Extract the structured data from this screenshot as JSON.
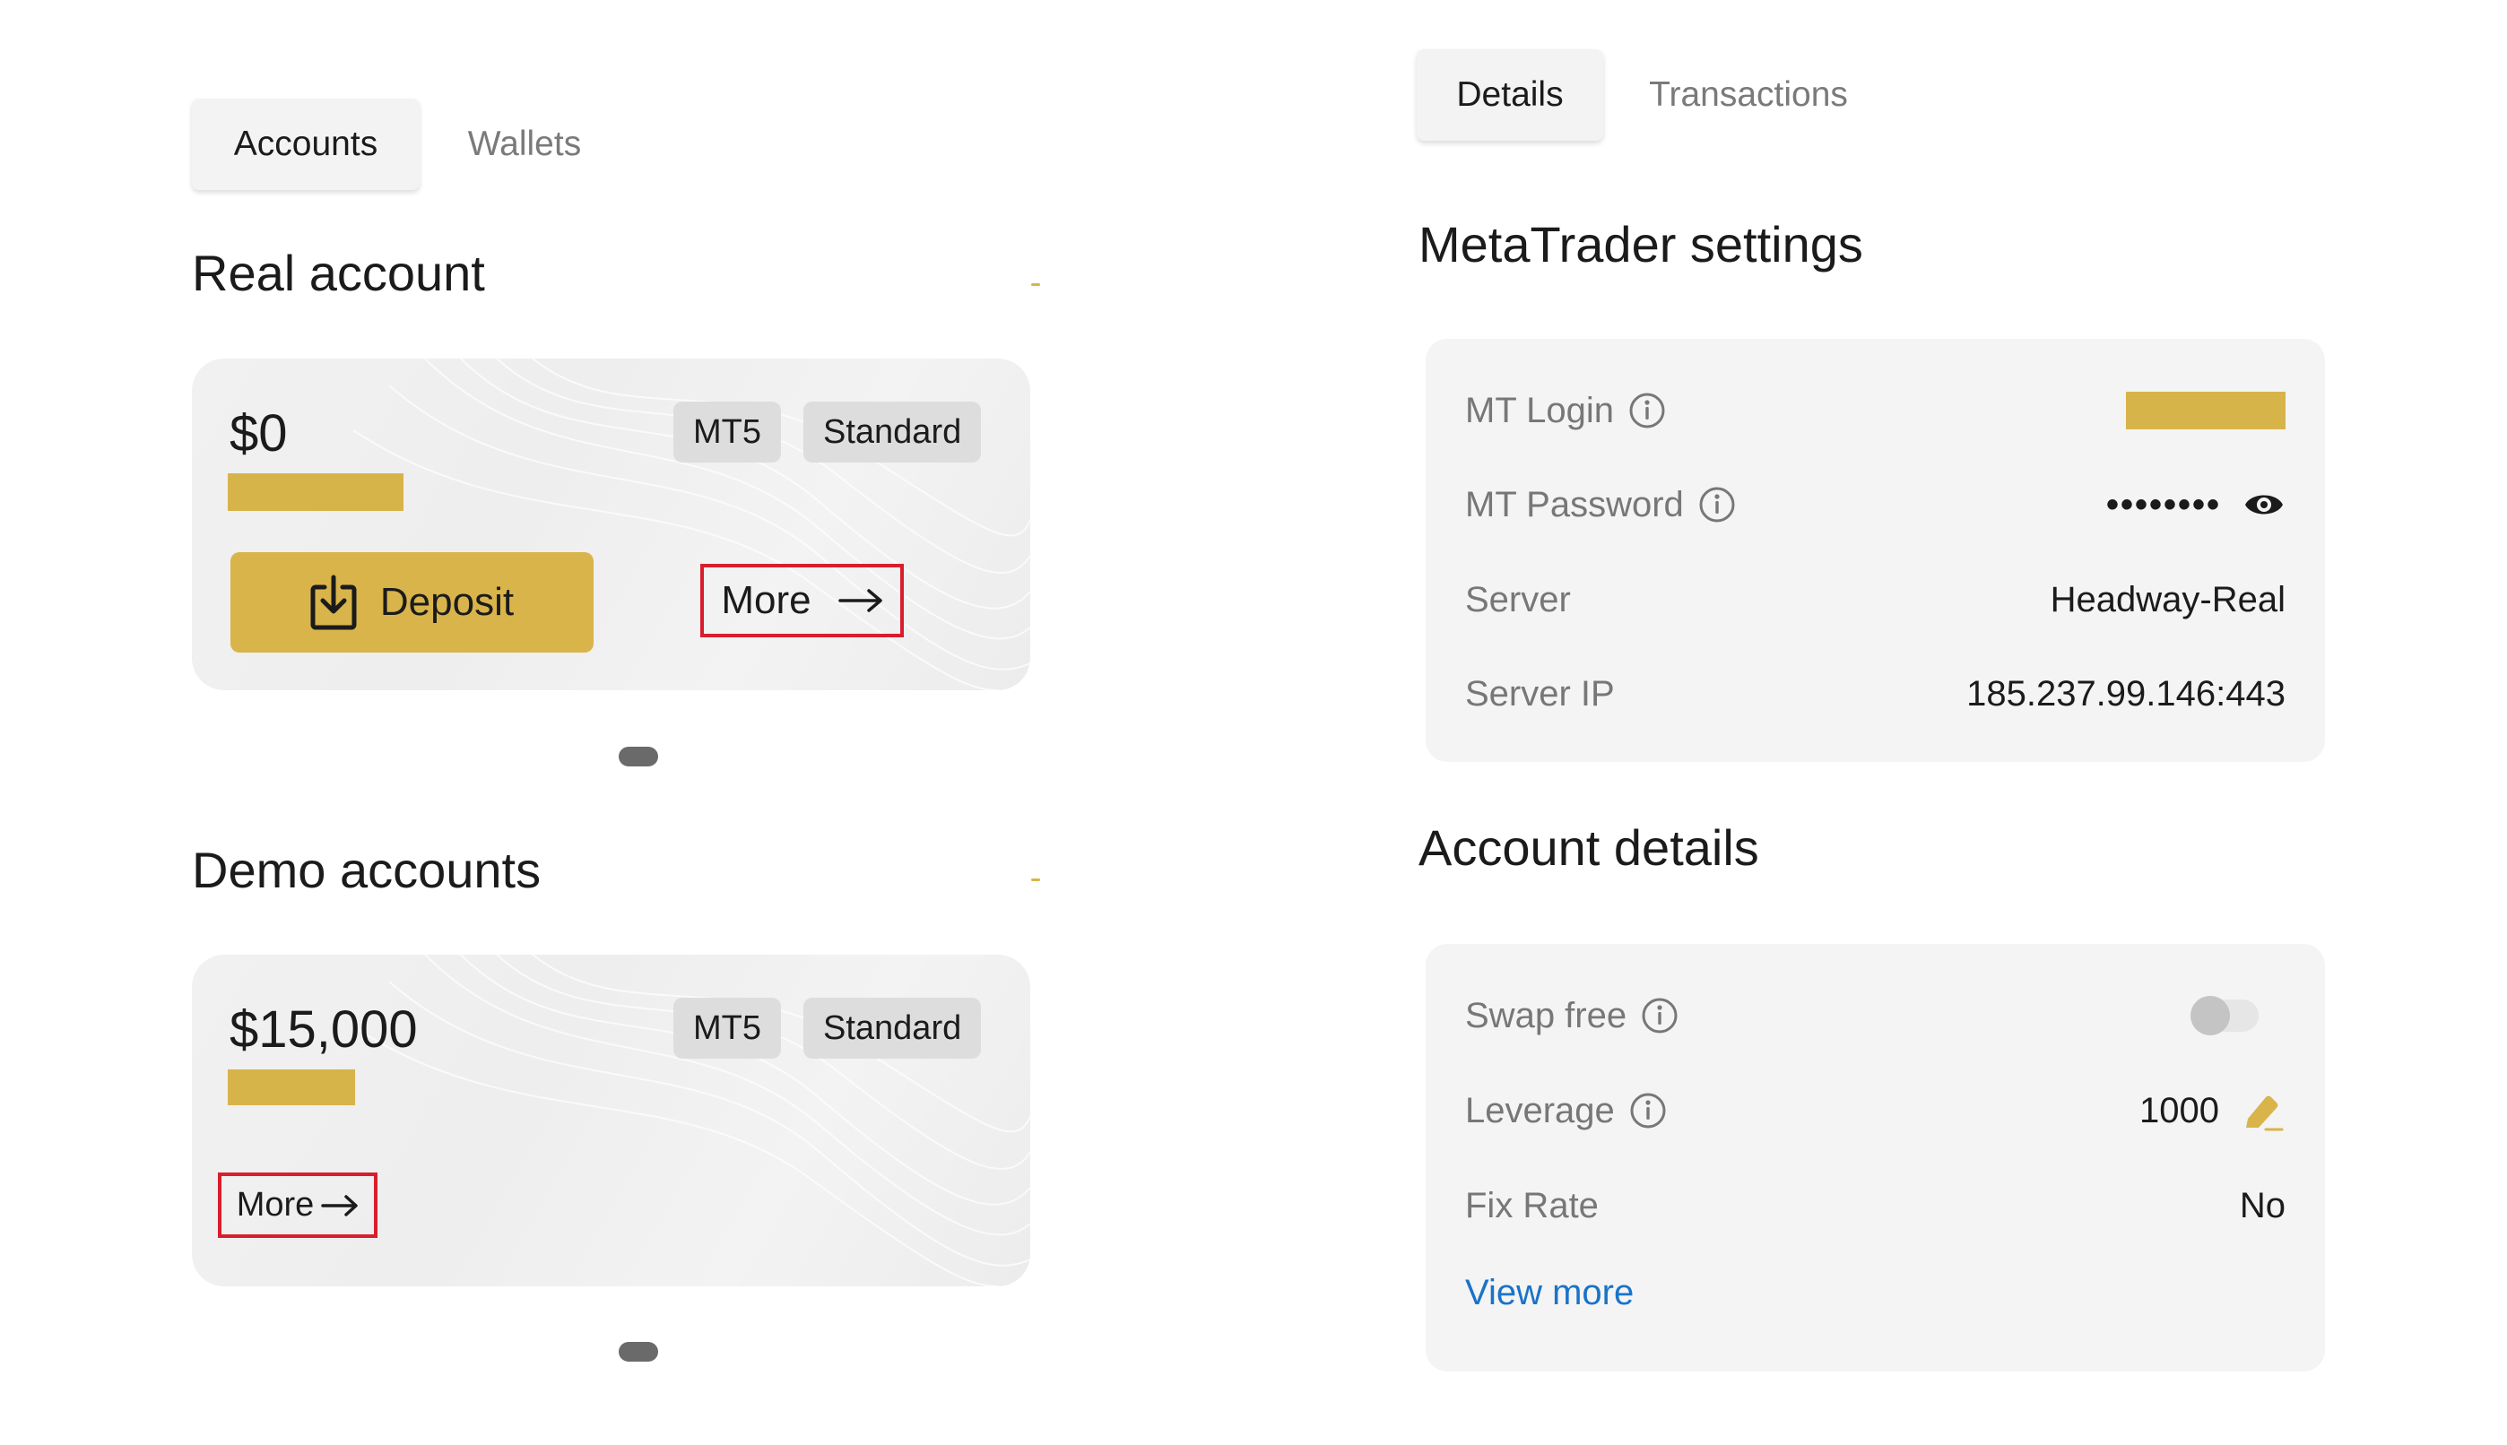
{
  "left": {
    "tabs": [
      {
        "label": "Accounts",
        "active": true
      },
      {
        "label": "Wallets",
        "active": false
      }
    ],
    "real": {
      "heading": "Real account",
      "balance": "$0",
      "platform": "MT5",
      "type": "Standard",
      "deposit_label": "Deposit",
      "more_label": "More"
    },
    "demo": {
      "heading": "Demo accounts",
      "balance": "$15,000",
      "platform": "MT5",
      "type": "Standard",
      "more_label": "More"
    }
  },
  "right": {
    "tabs": [
      {
        "label": "Details",
        "active": true
      },
      {
        "label": "Transactions",
        "active": false
      }
    ],
    "mt_settings": {
      "heading": "MetaTrader settings",
      "login_label": "MT Login",
      "password_label": "MT Password",
      "password_value": "••••••••",
      "server_label": "Server",
      "server_value": "Headway-Real",
      "server_ip_label": "Server IP",
      "server_ip_value": "185.237.99.146:443"
    },
    "account_details": {
      "heading": "Account details",
      "swap_free_label": "Swap free",
      "swap_free_enabled": false,
      "leverage_label": "Leverage",
      "leverage_value": "1000",
      "fix_rate_label": "Fix Rate",
      "fix_rate_value": "No",
      "view_more_label": "View more"
    }
  },
  "colors": {
    "accent_gold": "#d8b44b",
    "highlight_red": "#d81e2c",
    "link_blue": "#1a73c8"
  }
}
